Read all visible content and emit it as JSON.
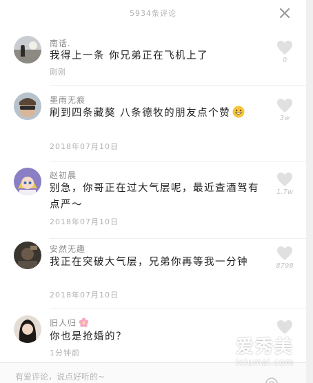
{
  "header": {
    "title": "5934条评论"
  },
  "comments": [
    {
      "username": "南话.",
      "text": "我得上一条 你兄弟正在飞机上了",
      "time": "刚刚",
      "likes": "0"
    },
    {
      "username": "墨雨无痕",
      "text": "刷到四条藏獒 八条德牧的朋友点个赞",
      "emoji": "grinning-face",
      "time": "2018年07月10日",
      "likes": "3w"
    },
    {
      "username": "赵初晨",
      "text": "别急，你哥正在过大气层呢，最近查酒驾有点严～",
      "time": "2018年07月10日",
      "likes": "1.7w"
    },
    {
      "username": "安然无趣",
      "text": "我正在突破大气层，兄弟你再等我一分钟",
      "time": "2018年07月10日",
      "likes": "8798"
    },
    {
      "username": "旧人归",
      "username_emoji": "cherry-blossom",
      "text": "你也是抢婚的？",
      "time": "1分钟前",
      "likes": ""
    }
  ],
  "composer": {
    "placeholder": "有爱评论，说点好听的~"
  },
  "watermark": {
    "main": "爱秀美",
    "sub": "ixiumei.com"
  },
  "icons": {
    "like": "heart-icon",
    "close": "close-icon",
    "send": "at-icon"
  },
  "colors": {
    "heart": "#e0e0e0",
    "text": "#222222",
    "muted": "#b0b0b0"
  }
}
